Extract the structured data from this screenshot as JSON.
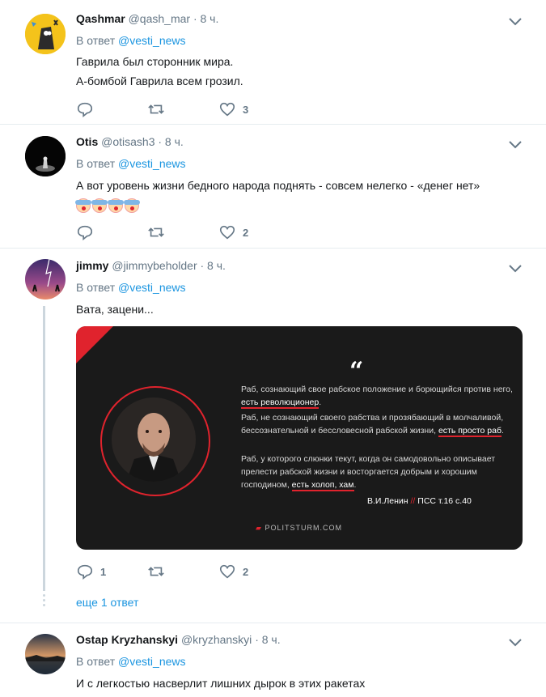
{
  "tweets": [
    {
      "name": "Qashmar",
      "handle": "@qash_mar",
      "time": "· 8 ч.",
      "reply_prefix": "В ответ",
      "reply_mention": "@vesti_news",
      "text_lines": [
        "Гаврила был сторонник мира.",
        "А-бомбой Гаврила всем грозил."
      ],
      "reply_count": "",
      "retweet_count": "",
      "like_count": "3"
    },
    {
      "name": "Otis",
      "handle": "@otisash3",
      "time": "· 8 ч.",
      "reply_prefix": "В ответ",
      "reply_mention": "@vesti_news",
      "text_lines": [
        "А вот уровень жизни бедного народа поднять - совсем нелегко - «денег нет»"
      ],
      "reply_count": "",
      "retweet_count": "",
      "like_count": "2"
    },
    {
      "name": "jimmy",
      "handle": "@jimmybeholder",
      "time": "· 8 ч.",
      "reply_prefix": "В ответ",
      "reply_mention": "@vesti_news",
      "text_lines": [
        "Вата, зацени..."
      ],
      "reply_count": "1",
      "retweet_count": "",
      "like_count": "2",
      "more_replies": "еще 1 ответ"
    },
    {
      "name": "Ostap Kryzhanskyi",
      "handle": "@kryzhanskyi",
      "time": "· 8 ч.",
      "reply_prefix": "В ответ",
      "reply_mention": "@vesti_news",
      "text_lines": [
        "И с легкостью насверлит лишних дырок в этих ракетах"
      ]
    }
  ],
  "quote_card": {
    "quote_mark": "“",
    "p1_a": "Раб, сознающий свое рабское положение и борющийся против него, ",
    "p1_ul": "есть революционер",
    "p1_b": ".",
    "p2_a": "Раб, не сознающий своего рабства и прозябающий в молчаливой, бессознательной и бессловесной рабской жизни, ",
    "p2_ul": "есть просто раб",
    "p2_b": ".",
    "p3_a": "Раб, у которого слюнки текут, когда он самодовольно описывает прелести рабской жизни и восторгается добрым и хорошим господином, ",
    "p3_ul": "есть холоп, хам",
    "p3_b": ".",
    "author": "В.И.Ленин",
    "sep": "//",
    "source": "ПСС т.16 с.40",
    "brand": "POLITSTURM.COM"
  },
  "icons": {
    "reply": "reply-icon",
    "retweet": "retweet-icon",
    "like": "heart-icon",
    "menu": "chevron-down-icon"
  },
  "colors": {
    "link": "#1b95e0",
    "muted": "#657786",
    "accent_red": "#e0232d"
  }
}
